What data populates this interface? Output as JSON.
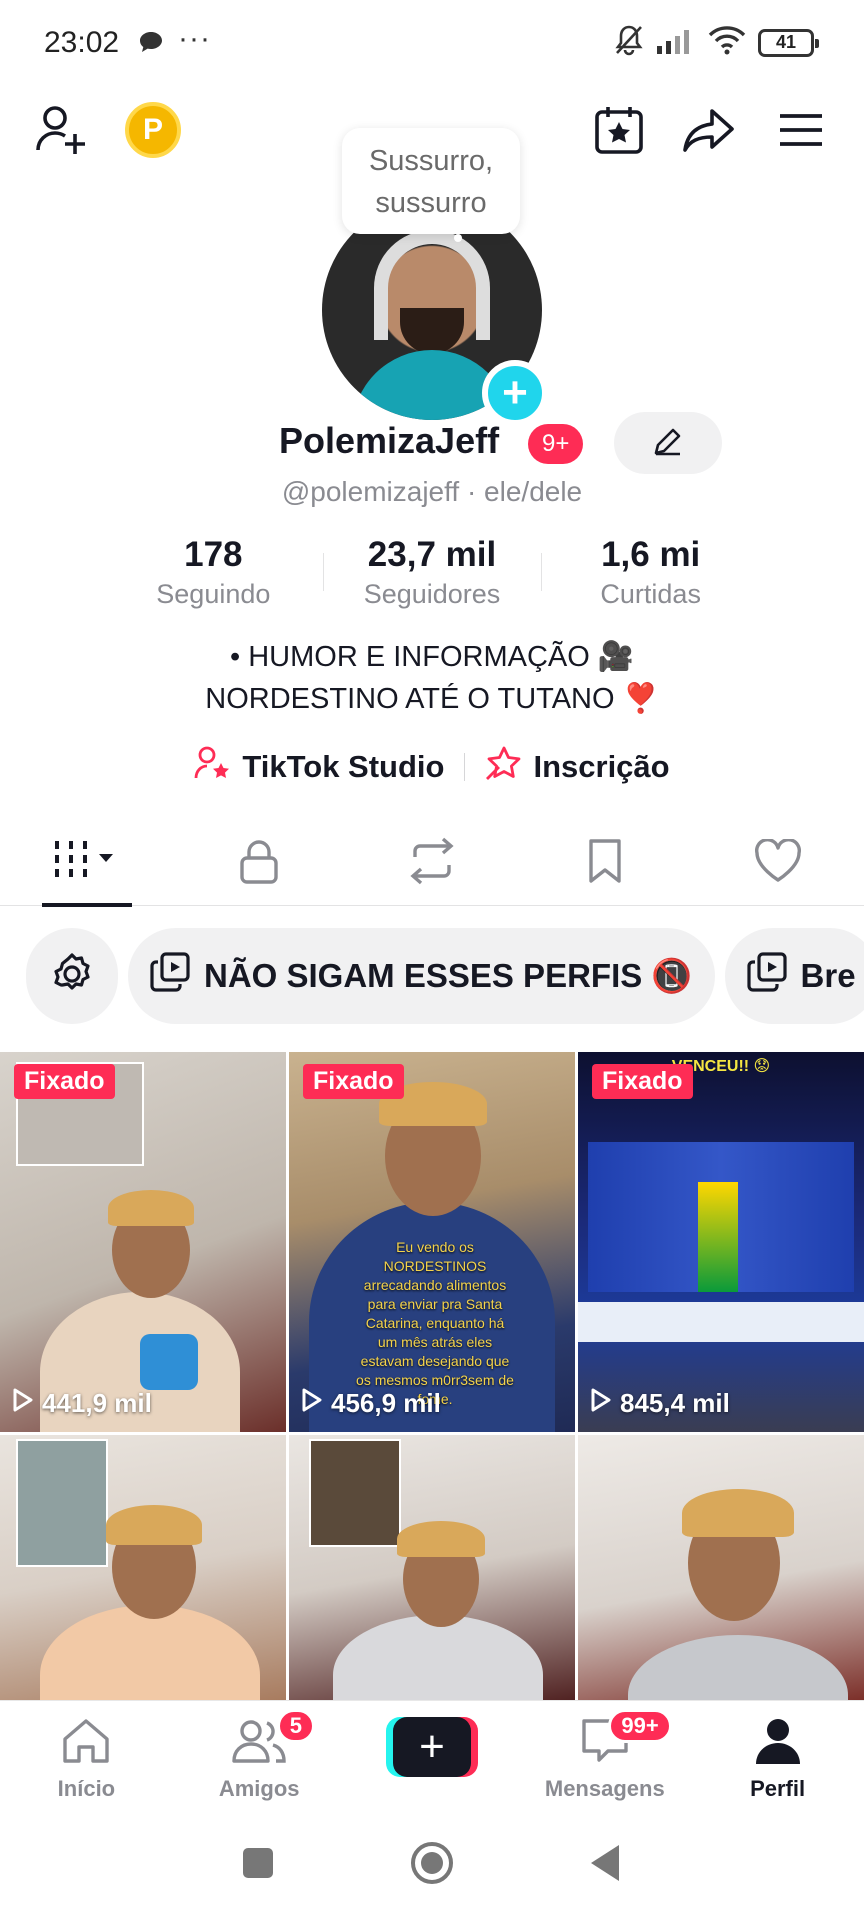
{
  "status_bar": {
    "time": "23:02",
    "dots": "···",
    "battery": "41",
    "icons": [
      "chat-bubble-icon",
      "muted-bell-icon",
      "signal-icon",
      "wifi-icon",
      "battery-icon"
    ]
  },
  "top_nav": {
    "icons": [
      "add-user-icon",
      "coin-icon",
      "calendar-star-icon",
      "share-arrow-icon",
      "menu-icon"
    ],
    "coin_letter": "P"
  },
  "profile": {
    "bubble_text_line1": "Sussurro,",
    "bubble_text_line2": "sussurro",
    "name": "PolemizaJeff",
    "notification_badge": "9+",
    "handle": "@polemizajeff · ele/dele",
    "stats": [
      {
        "value": "178",
        "label": "Seguindo"
      },
      {
        "value": "23,7 mil",
        "label": "Seguidores"
      },
      {
        "value": "1,6 mi",
        "label": "Curtidas"
      }
    ],
    "bio_line1": "• HUMOR E INFORMAÇÃO 🎥",
    "bio_line2": "NORDESTINO ATÉ O TUTANO ❣️",
    "links": [
      {
        "label": "TikTok Studio",
        "icon": "person-star-icon"
      },
      {
        "label": "Inscrição",
        "icon": "star-badge-icon"
      }
    ]
  },
  "content_tabs": [
    {
      "name": "videos",
      "icon": "grid-bars-icon",
      "active": true
    },
    {
      "name": "private",
      "icon": "lock-icon",
      "active": false
    },
    {
      "name": "reposts",
      "icon": "repost-icon",
      "active": false
    },
    {
      "name": "favorites",
      "icon": "bookmark-icon",
      "active": false
    },
    {
      "name": "liked",
      "icon": "heart-icon",
      "active": false
    }
  ],
  "collections": [
    {
      "label": "NÃO SIGAM ESSES PERFIS 📵"
    },
    {
      "label": "Bre"
    }
  ],
  "videos": [
    {
      "pinned": "Fixado",
      "views": "441,9 mil"
    },
    {
      "pinned": "Fixado",
      "views": "456,9 mil",
      "caption": "Eu vendo os NORDESTINOS arrecadando alimentos para enviar pra Santa Catarina, enquanto há um mês atrás eles estavam desejando que os mesmos m0rr3sem de fome."
    },
    {
      "pinned": "Fixado",
      "views": "845,4 mil",
      "top_text": "VENCEU!! 😟"
    },
    {},
    {},
    {}
  ],
  "bottom_nav": [
    {
      "label": "Início",
      "icon": "home-icon",
      "active": false
    },
    {
      "label": "Amigos",
      "icon": "friends-icon",
      "active": false,
      "badge": "5"
    },
    {
      "label": "",
      "icon": "create-plus-icon",
      "active": false
    },
    {
      "label": "Mensagens",
      "icon": "message-icon",
      "active": false,
      "badge": "99+"
    },
    {
      "label": "Perfil",
      "icon": "profile-icon",
      "active": true
    }
  ],
  "colors": {
    "accent_red": "#fe2c55",
    "accent_cyan": "#25f4ee",
    "text_primary": "#161823",
    "text_secondary": "#8a8b91"
  }
}
